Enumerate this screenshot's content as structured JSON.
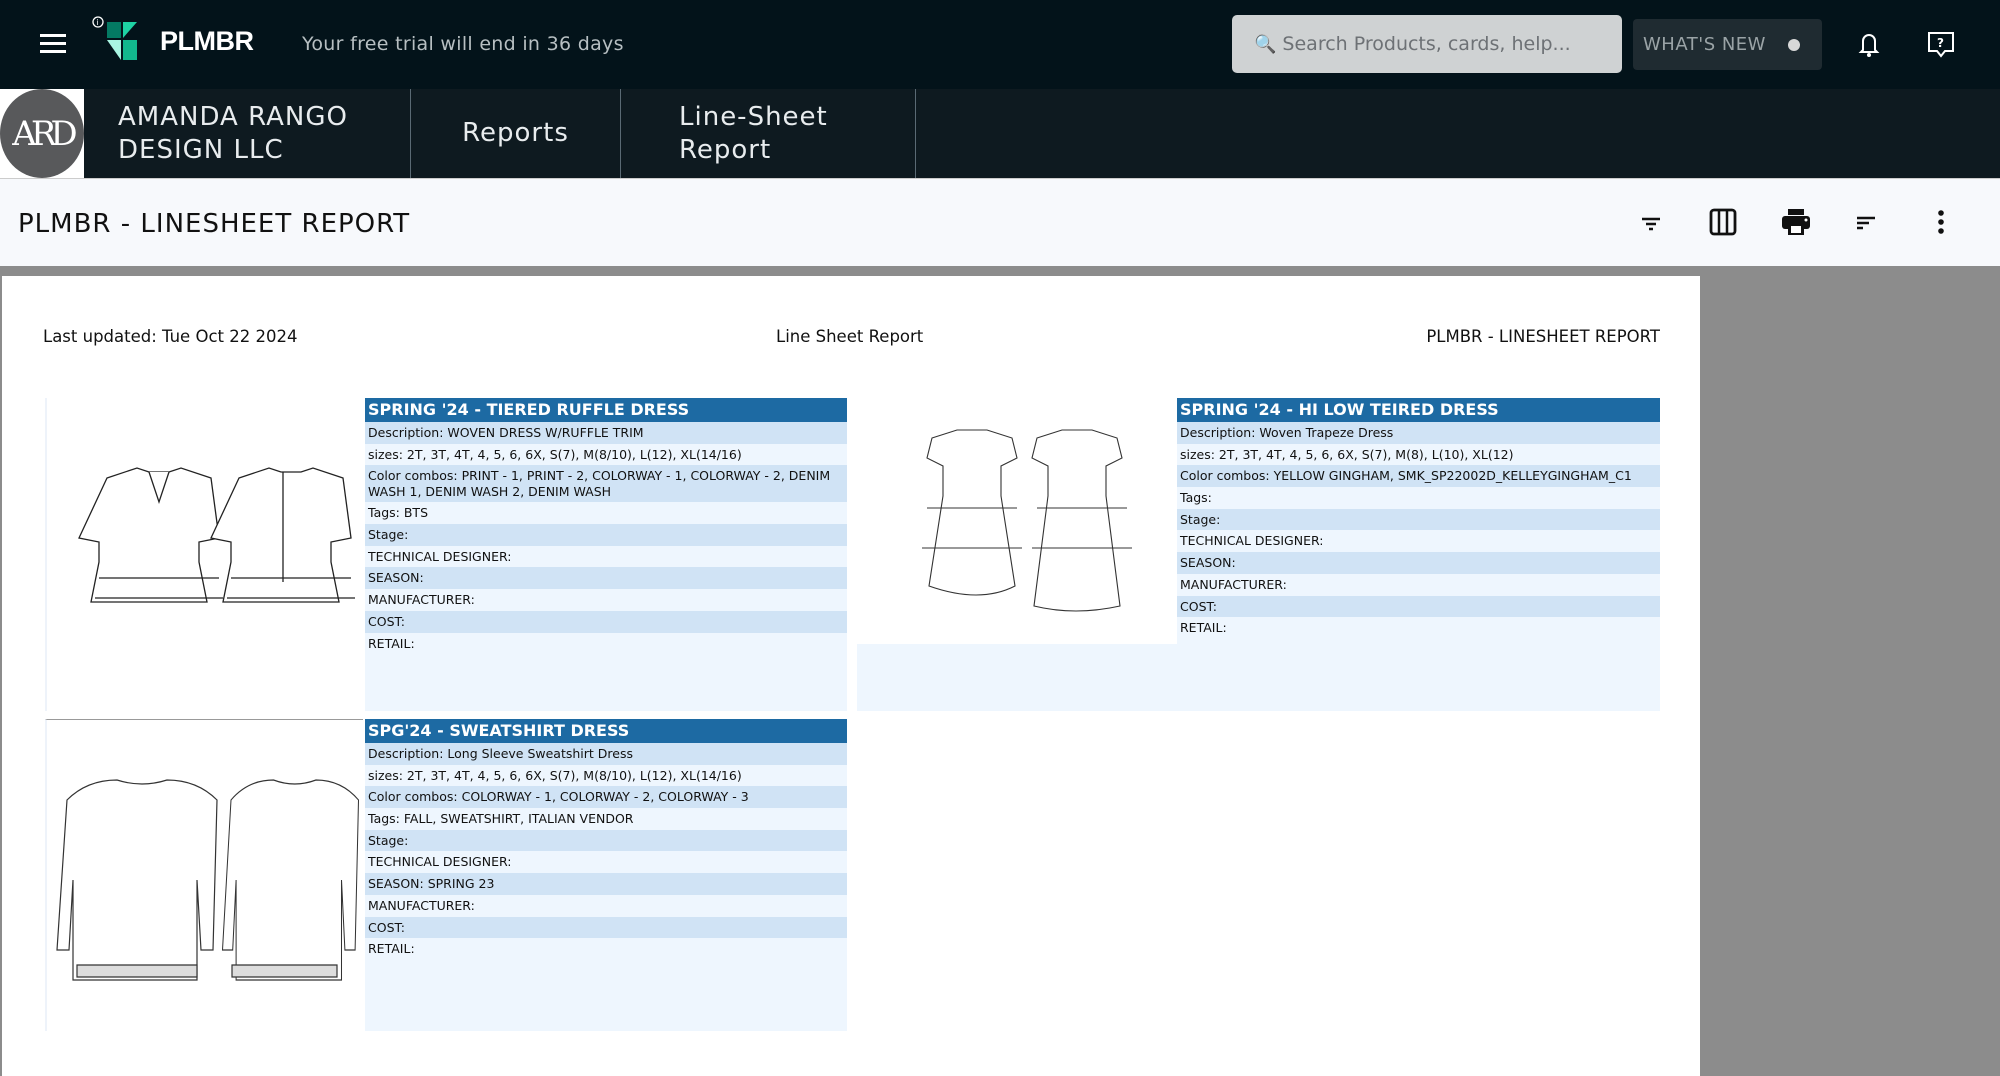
{
  "topbar": {
    "brand": "PLMBR",
    "trial_text": "Your free trial will end in 36 days",
    "search_placeholder": "Search Products, cards, help...",
    "whats_new": "WHAT'S NEW",
    "icons": [
      "menu-icon",
      "info-icon",
      "bell-icon",
      "help-icon",
      "search-icon"
    ]
  },
  "breadcrumb": {
    "avatar_initials": "ARD",
    "company": "AMANDA RANGO DESIGN LLC",
    "reports": "Reports",
    "current": "Line-Sheet Report"
  },
  "titlebar": {
    "title": "PLMBR - LINESHEET REPORT",
    "icons": [
      "filter-icon",
      "columns-icon",
      "print-icon",
      "sort-icon",
      "more-vert-icon"
    ]
  },
  "report": {
    "last_updated": "Last updated: Tue Oct 22 2024",
    "center_title": "Line Sheet Report",
    "right_title": "PLMBR - LINESHEET REPORT",
    "header_color": "#1d6aa3",
    "products": [
      {
        "title": "SPRING '24 - TIERED RUFFLE DRESS",
        "rows": [
          "Description: WOVEN DRESS W/RUFFLE TRIM",
          "sizes: 2T, 3T, 4T, 4, 5, 6, 6X, S(7), M(8/10), L(12), XL(14/16)",
          "Color combos: PRINT - 1, PRINT - 2, COLORWAY - 1, COLORWAY - 2, DENIM WASH 1, DENIM WASH 2, DENIM WASH",
          "Tags: BTS",
          "Stage:",
          "TECHNICAL DESIGNER:",
          "SEASON:",
          "MANUFACTURER:",
          "COST:",
          "RETAIL:"
        ]
      },
      {
        "title": "SPRING '24 - HI LOW TEIRED DRESS",
        "rows": [
          "Description: Woven Trapeze Dress",
          "sizes: 2T, 3T, 4T, 4, 5, 6, 6X, S(7), M(8), L(10), XL(12)",
          "Color combos: YELLOW GINGHAM, SMK_SP22002D_KELLEYGINGHAM_C1",
          "Tags:",
          "Stage:",
          "TECHNICAL DESIGNER:",
          "SEASON:",
          "MANUFACTURER:",
          "COST:",
          "RETAIL:"
        ]
      },
      {
        "title": "SPG'24 - SWEATSHIRT DRESS",
        "rows": [
          "Description: Long Sleeve Sweatshirt Dress",
          "sizes: 2T, 3T, 4T, 4, 5, 6, 6X, S(7), M(8/10), L(12), XL(14/16)",
          "Color combos: COLORWAY - 1, COLORWAY - 2, COLORWAY - 3",
          "Tags: FALL, SWEATSHIRT, ITALIAN VENDOR",
          "Stage:",
          "TECHNICAL DESIGNER:",
          "SEASON: SPRING 23",
          "MANUFACTURER:",
          "COST:",
          "RETAIL:"
        ]
      }
    ]
  }
}
